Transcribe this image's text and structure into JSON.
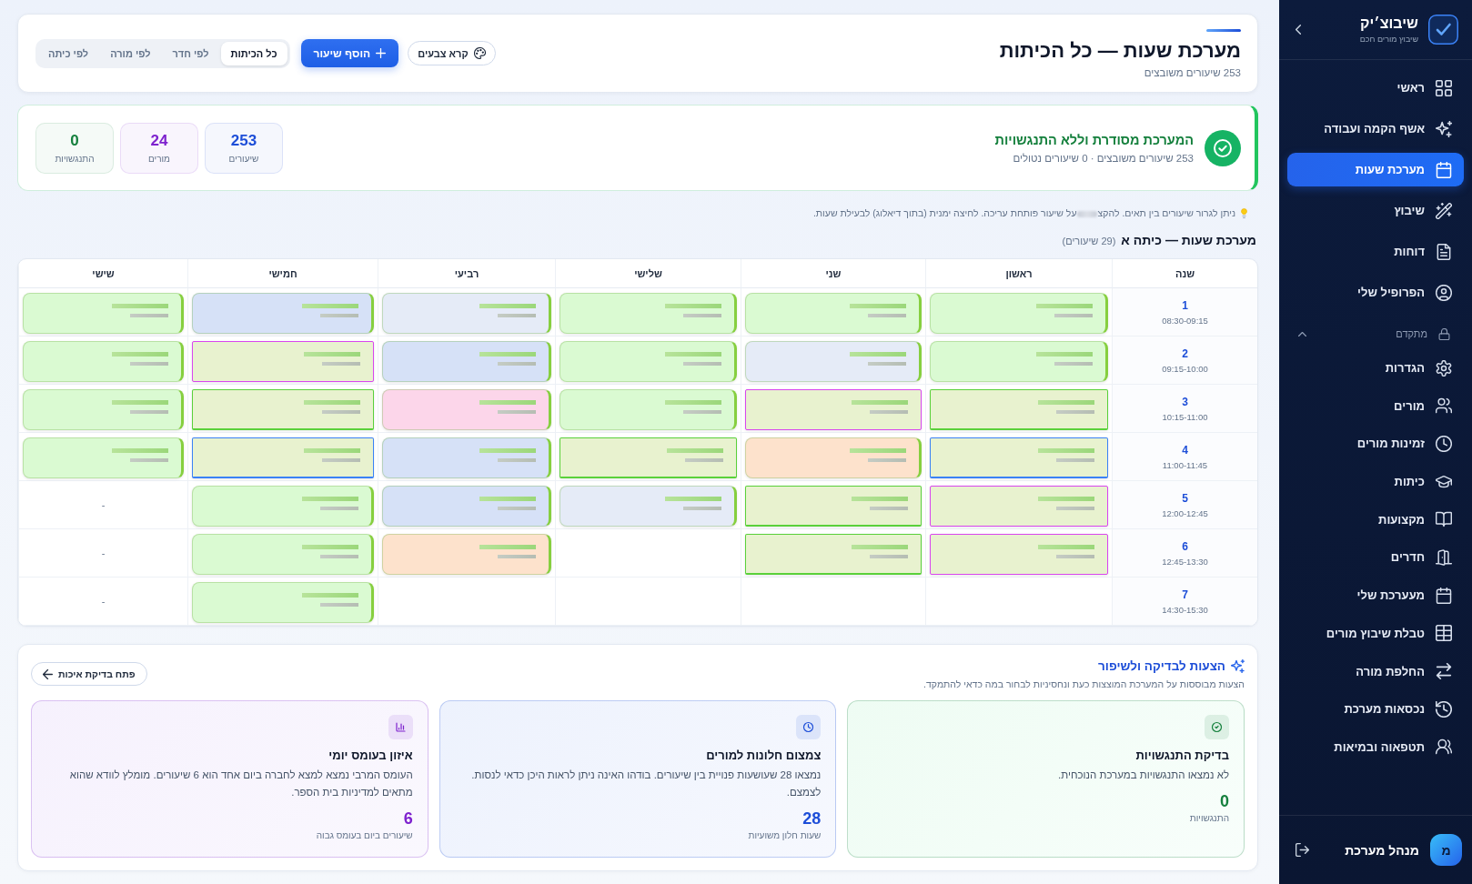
{
  "sidebar": {
    "brand": {
      "name": "שיבוצ׳יק",
      "tagline": "שיבוץ מורים חכם"
    },
    "items": [
      {
        "label": "ראשי",
        "selected": false
      },
      {
        "label": "אשף הקמה ועבודה",
        "selected": false
      },
      {
        "label": "מערכת שעות",
        "selected": true
      },
      {
        "label": "שיבוץ",
        "selected": false
      },
      {
        "label": "דוחות",
        "selected": false
      },
      {
        "label": "הפרופיל שלי",
        "selected": false
      }
    ],
    "section": {
      "label": "מתקדם",
      "expanded": true,
      "items": [
        {
          "label": "הגדרות",
          "selected": false
        },
        {
          "label": "מורים",
          "selected": false
        },
        {
          "label": "זמינות מורים",
          "selected": false
        },
        {
          "label": "כיתות",
          "selected": false
        },
        {
          "label": "מקצועות",
          "selected": false
        },
        {
          "label": "חדרים",
          "selected": false
        },
        {
          "label": "מעערכת שלי",
          "selected": false
        },
        {
          "label": "טבלת שיבוץ מורים",
          "selected": false
        },
        {
          "label": "החלפת מורה",
          "selected": false
        },
        {
          "label": "נכסאות מערכת",
          "selected": false
        },
        {
          "label": "תטפאוה ובמיאות",
          "selected": false
        }
      ]
    },
    "user": {
      "initial": "מ",
      "name": "מנהל מערכת"
    }
  },
  "header": {
    "title": "מערכת שעות — כל הכיתות",
    "subtitle": "253 שיעורים משובצים",
    "buttons": [
      {
        "label": "קרא צבעים",
        "kind": "outline"
      },
      {
        "label": "הוסף שיעור",
        "kind": "primary"
      }
    ],
    "views": [
      {
        "label": "כל הכיתות",
        "selected": true
      },
      {
        "label": "לפי חדר",
        "selected": false
      },
      {
        "label": "לפי מורה",
        "selected": false
      },
      {
        "label": "לפי כיתה",
        "selected": false
      }
    ]
  },
  "status": {
    "title": "המערכת מסודרת וללא התנגשויות",
    "detail": "253 שיעורים משובצים · 0 שיעורים נטולים",
    "stats": [
      {
        "value": "253",
        "label": "שיעורים",
        "color": "#1d4ed8"
      },
      {
        "value": "24",
        "label": "מורים",
        "color": "#7e22ce"
      },
      {
        "value": "0",
        "label": "התנגשויות",
        "color": "#15803d"
      }
    ]
  },
  "hint": {
    "start": "ניתן לגרור שיעורים בין תאים. להקצ",
    "end": "על שיעור פותחת עריכה. לחיצה ימנית (בתוך דיאלוג) לבעילת שעות."
  },
  "timetable": {
    "title": "מערכת שעות — כיתה א",
    "count": "(29 שיעורים)",
    "columns": [
      "שנה",
      "ראשון",
      "שני",
      "שלישי",
      "רביעי",
      "חמישי",
      "שישי"
    ],
    "rows": [
      {
        "period": "1",
        "time": "08:30-09:15",
        "cells": [
          {
            "kind": "lesson",
            "color": "#dafad2"
          },
          {
            "kind": "lesson",
            "color": "#dafad2"
          },
          {
            "kind": "lesson",
            "color": "#dafad2"
          },
          {
            "kind": "lesson",
            "color": "#e5ebf7"
          },
          {
            "kind": "lesson",
            "color": "#d6e1f7"
          },
          {
            "kind": "lesson",
            "color": "#dafad2"
          }
        ]
      },
      {
        "period": "2",
        "time": "09:15-10:00",
        "cells": [
          {
            "kind": "lesson",
            "color": "#dafad2"
          },
          {
            "kind": "lesson",
            "color": "#e5ebf7"
          },
          {
            "kind": "lesson",
            "color": "#dafad2"
          },
          {
            "kind": "lesson",
            "color": "#d6e1f7"
          },
          {
            "kind": "grouped",
            "color": "#e8f2cf",
            "outline": {
              "color": "#d946ef"
            },
            "conflict": false
          },
          {
            "kind": "lesson",
            "color": "#dafad2"
          }
        ]
      },
      {
        "period": "3",
        "time": "10:15-11:00",
        "cells": [
          {
            "kind": "grouped",
            "color": "#e8f2cf",
            "outline": {
              "color": "#5ad13a"
            },
            "conflict": true
          },
          {
            "kind": "grouped",
            "color": "#e8f2cf",
            "outline": {
              "color": "#d946ef"
            },
            "conflict": false
          },
          {
            "kind": "lesson",
            "color": "#dafad2"
          },
          {
            "kind": "lesson",
            "color": "#fcd6ea"
          },
          {
            "kind": "grouped",
            "color": "#e8f2cf",
            "outline": {
              "color": "#5ad13a"
            },
            "conflict": true
          },
          {
            "kind": "lesson",
            "color": "#dafad2"
          }
        ]
      },
      {
        "period": "4",
        "time": "11:00-11:45",
        "cells": [
          {
            "kind": "grouped",
            "color": "#e8f2cf",
            "outline": {
              "color": "#3b82f6"
            },
            "conflict": true
          },
          {
            "kind": "lesson",
            "color": "#fde2cc"
          },
          {
            "kind": "grouped",
            "color": "#e8f2cf",
            "outline": {
              "color": "#5ad13a"
            },
            "conflict": true
          },
          {
            "kind": "lesson",
            "color": "#d6e1f7"
          },
          {
            "kind": "grouped",
            "color": "#e8f2cf",
            "outline": {
              "color": "#3b82f6"
            },
            "conflict": true
          },
          {
            "kind": "lesson",
            "color": "#dafad2"
          }
        ]
      },
      {
        "period": "5",
        "time": "12:00-12:45",
        "cells": [
          {
            "kind": "grouped",
            "color": "#e8f2cf",
            "outline": {
              "color": "#d946ef"
            },
            "conflict": false
          },
          {
            "kind": "grouped",
            "color": "#e8f2cf",
            "outline": {
              "color": "#5ad13a"
            },
            "conflict": true
          },
          {
            "kind": "lesson",
            "color": "#e5ebf7"
          },
          {
            "kind": "lesson",
            "color": "#d6e1f7"
          },
          {
            "kind": "lesson",
            "color": "#dafad2"
          },
          {
            "kind": "dash",
            "text": "-"
          }
        ]
      },
      {
        "period": "6",
        "time": "12:45-13:30",
        "cells": [
          {
            "kind": "grouped",
            "color": "#e8f2cf",
            "outline": {
              "color": "#d946ef"
            },
            "conflict": false
          },
          {
            "kind": "grouped",
            "color": "#e8f2cf",
            "outline": {
              "color": "#5ad13a"
            },
            "conflict": true
          },
          {
            "kind": "empty"
          },
          {
            "kind": "lesson",
            "color": "#fde2cc"
          },
          {
            "kind": "lesson",
            "color": "#dafad2"
          },
          {
            "kind": "dash",
            "text": "-"
          }
        ]
      },
      {
        "period": "7",
        "time": "14:30-15:30",
        "cells": [
          {
            "kind": "empty"
          },
          {
            "kind": "empty"
          },
          {
            "kind": "empty"
          },
          {
            "kind": "empty"
          },
          {
            "kind": "lesson",
            "color": "#dafad2"
          },
          {
            "kind": "dash",
            "text": "-"
          }
        ]
      }
    ]
  },
  "suggestions": {
    "title": "הצעות לבדיקה ולשיפור",
    "subtitle": "הצעות מבוססות על המערכת המוצצות כעת ונחסיניות לבחור במה כדאי להתמקד.",
    "button": "פתח בדיקת איכות",
    "cards": [
      {
        "title": "בדיקת התנגשויות",
        "text": "לא נמצאו התנגשויות במערכת הנוכחית.",
        "value": "0",
        "caption": "התנגשויות",
        "color": "#15803d"
      },
      {
        "title": "צמצום חלונות למורים",
        "text": "נמצאו 28 שעושעות פנויית בין שיעורים. בודהו האינה ניתן לראות היכן כדאי לנסות. לצמצם.",
        "value": "28",
        "caption": "שעות חלון משועיות",
        "color": "#1d4ed8"
      },
      {
        "title": "איזון בעומס יומי",
        "text": "העומס המרבי נמצא למצא לחברה ביום אחד הוא 6 שיעורים. מומלץ לוודא שהוא מתאים למדיניות בית הספר.",
        "value": "6",
        "caption": "שיעורים ביום בעומס גבוה",
        "color": "#7e22ce"
      }
    ]
  }
}
